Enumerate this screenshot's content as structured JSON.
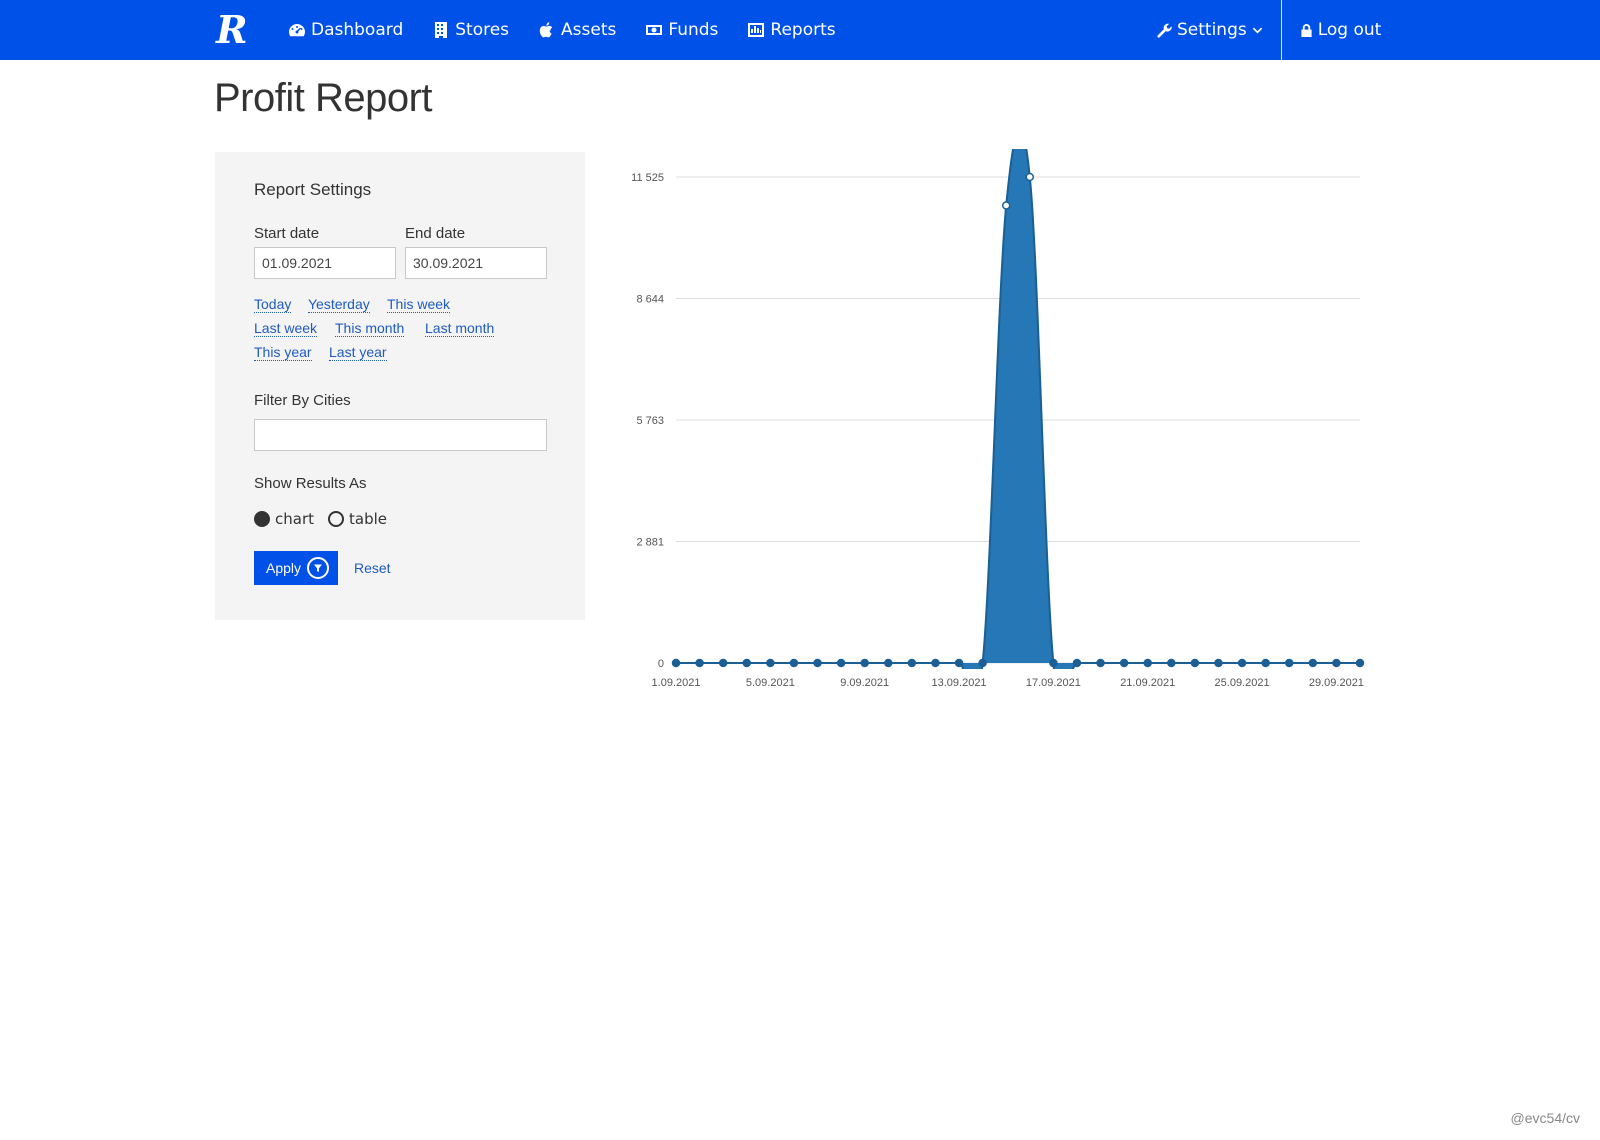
{
  "nav": {
    "logo": "R",
    "items": [
      {
        "label": "Dashboard",
        "icon": "dashboard-icon"
      },
      {
        "label": "Stores",
        "icon": "building-icon"
      },
      {
        "label": "Assets",
        "icon": "apple-icon"
      },
      {
        "label": "Funds",
        "icon": "money-icon"
      },
      {
        "label": "Reports",
        "icon": "bar-chart-icon"
      }
    ],
    "settings": "Settings",
    "logout": "Log out",
    "brand_color": "#0051e8"
  },
  "page": {
    "title": "Profit Report"
  },
  "settings_panel": {
    "heading": "Report Settings",
    "start_label": "Start date",
    "start_value": "01.09.2021",
    "end_label": "End date",
    "end_value": "30.09.2021",
    "quick_links": [
      "Today",
      "Yesterday",
      "This week",
      "Last week",
      "This month",
      "Last month",
      "This year",
      "Last year"
    ],
    "cities_label": "Filter By Cities",
    "cities_value": "",
    "show_label": "Show Results As",
    "options": [
      "chart",
      "table"
    ],
    "selected": "chart",
    "apply": "Apply",
    "reset": "Reset"
  },
  "chart_data": {
    "type": "area",
    "x": [
      "1.09.2021",
      "2.09.2021",
      "3.09.2021",
      "4.09.2021",
      "5.09.2021",
      "6.09.2021",
      "7.09.2021",
      "8.09.2021",
      "9.09.2021",
      "10.09.2021",
      "11.09.2021",
      "12.09.2021",
      "13.09.2021",
      "14.09.2021",
      "15.09.2021",
      "16.09.2021",
      "17.09.2021",
      "18.09.2021",
      "19.09.2021",
      "20.09.2021",
      "21.09.2021",
      "22.09.2021",
      "23.09.2021",
      "24.09.2021",
      "25.09.2021",
      "26.09.2021",
      "27.09.2021",
      "28.09.2021",
      "29.09.2021",
      "30.09.2021"
    ],
    "x_tick_labels": [
      "1.09.2021",
      "5.09.2021",
      "9.09.2021",
      "13.09.2021",
      "17.09.2021",
      "21.09.2021",
      "25.09.2021",
      "29.09.2021"
    ],
    "series": [
      {
        "values": [
          0,
          0,
          0,
          0,
          0,
          0,
          0,
          0,
          0,
          0,
          0,
          0,
          0,
          0,
          10850,
          11525,
          0,
          0,
          0,
          0,
          0,
          0,
          0,
          0,
          0,
          0,
          0,
          0,
          0,
          0
        ]
      }
    ],
    "y_ticks": [
      "0",
      "2 881",
      "5 763",
      "8 644",
      "11 525"
    ],
    "y_tick_values": [
      0,
      2881,
      5763,
      8644,
      11525
    ],
    "ylim": [
      0,
      11525
    ],
    "grid": true,
    "color": "#2577b5"
  },
  "watermark": "@evc54/cv"
}
